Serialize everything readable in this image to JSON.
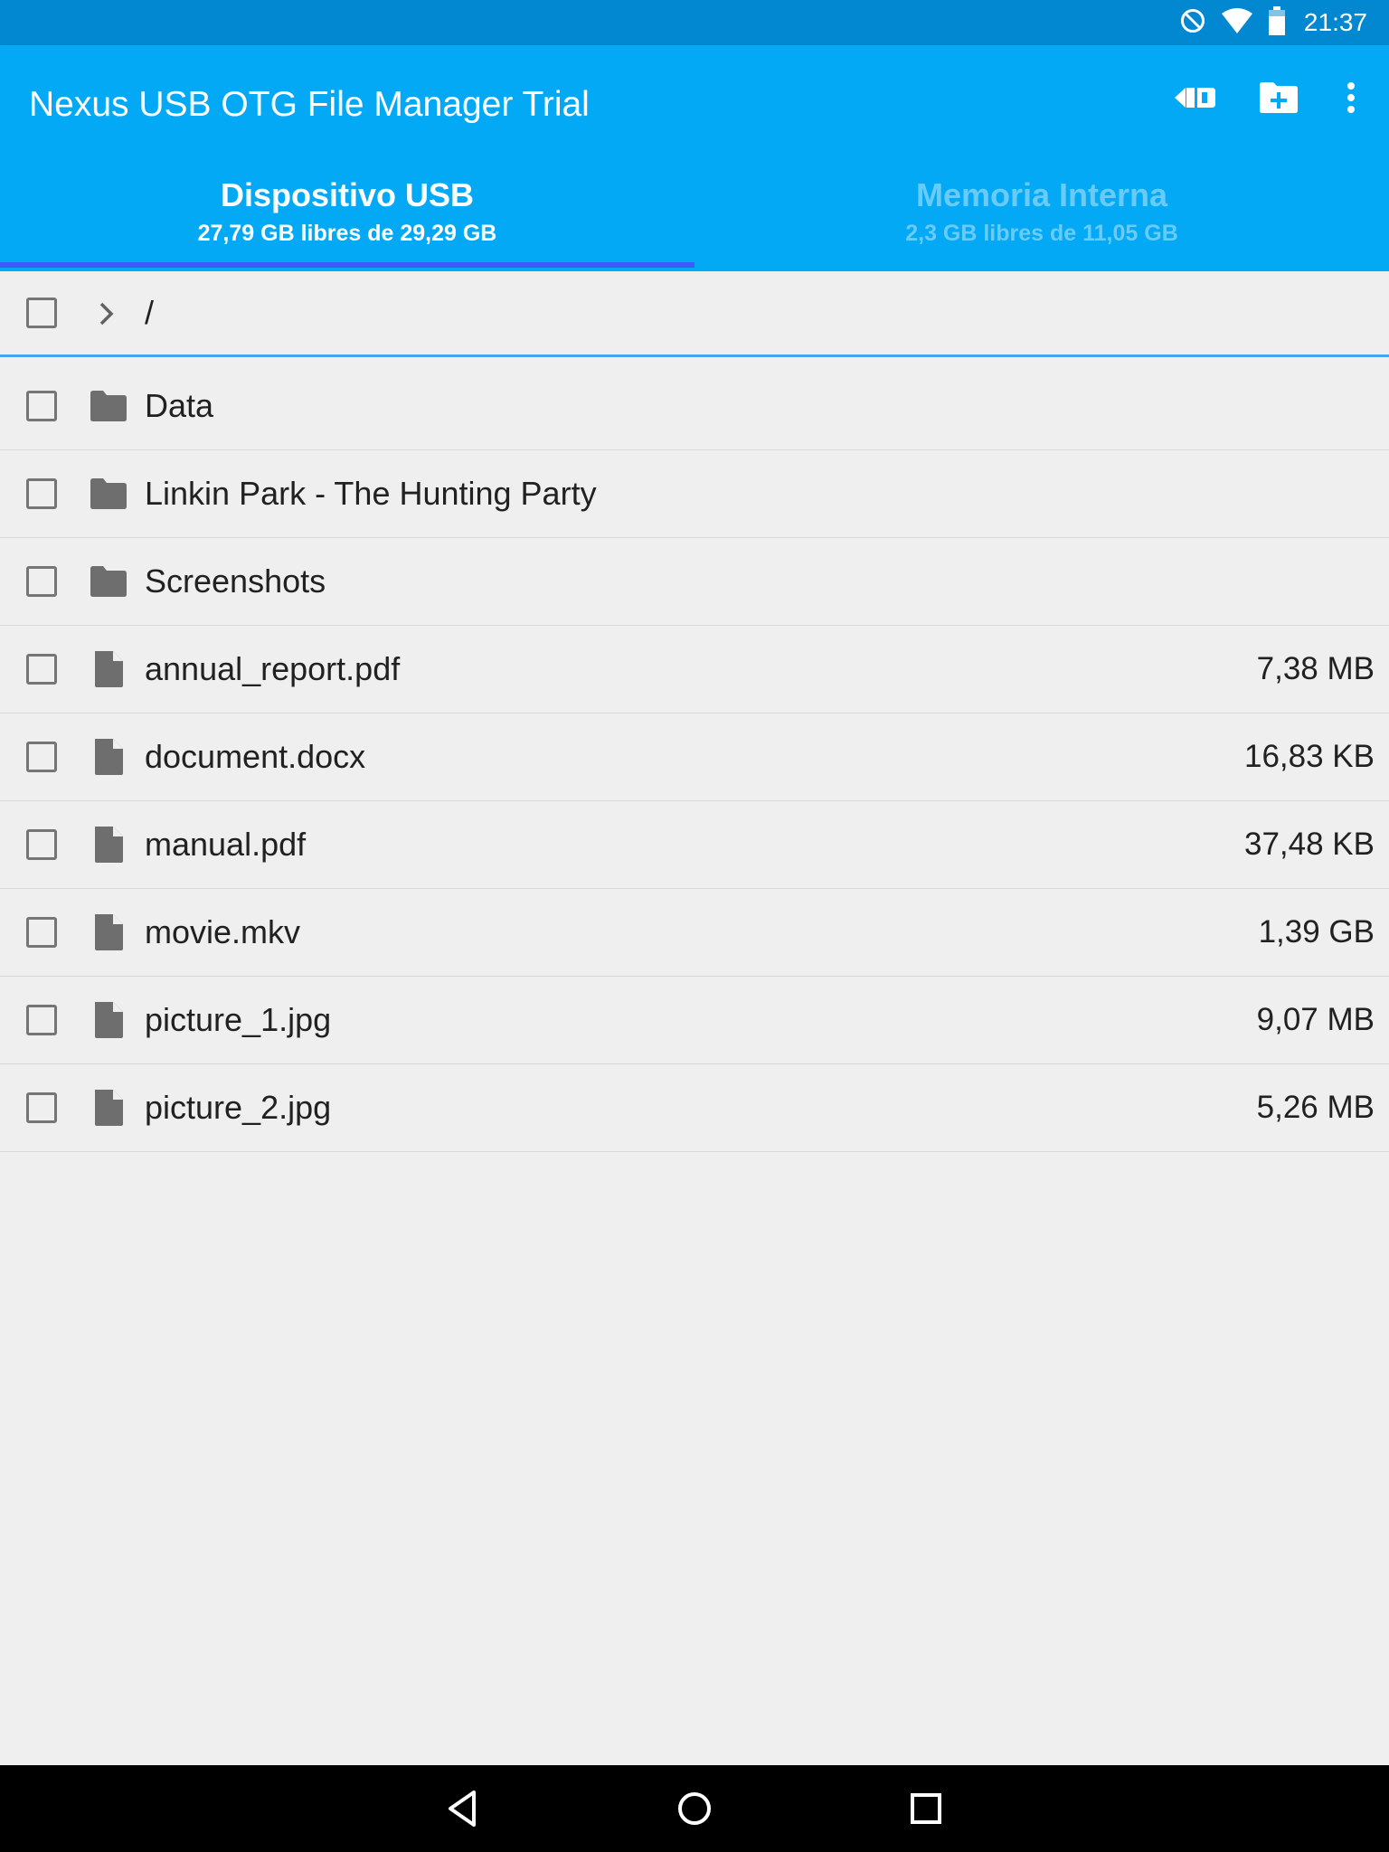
{
  "status_bar": {
    "time": "21:37",
    "icons": [
      "do-not-disturb-icon",
      "wifi-icon",
      "battery-icon"
    ],
    "background": "#0288d1"
  },
  "app_bar": {
    "title": "Nexus USB OTG File Manager Trial",
    "background": "#03a9f4",
    "actions": [
      "switch-storage-icon",
      "new-folder-icon",
      "more-vert-icon"
    ]
  },
  "tabs": [
    {
      "label": "Dispositivo USB",
      "subtitle": "27,79 GB libres de 29,29 GB",
      "selected": true
    },
    {
      "label": "Memoria Interna",
      "subtitle": "2,3 GB libres de 11,05 GB",
      "selected": false
    }
  ],
  "tab_indicator_color": "#3d5afe",
  "path": {
    "current": "/"
  },
  "files": [
    {
      "name": "Data",
      "type": "folder",
      "size": ""
    },
    {
      "name": "Linkin Park - The Hunting Party",
      "type": "folder",
      "size": ""
    },
    {
      "name": "Screenshots",
      "type": "folder",
      "size": ""
    },
    {
      "name": "annual_report.pdf",
      "type": "file",
      "size": "7,38 MB"
    },
    {
      "name": "document.docx",
      "type": "file",
      "size": "16,83 KB"
    },
    {
      "name": "manual.pdf",
      "type": "file",
      "size": "37,48 KB"
    },
    {
      "name": "movie.mkv",
      "type": "file",
      "size": "1,39 GB"
    },
    {
      "name": "picture_1.jpg",
      "type": "file",
      "size": "9,07 MB"
    },
    {
      "name": "picture_2.jpg",
      "type": "file",
      "size": "5,26 MB"
    }
  ],
  "nav_bar": {
    "buttons": [
      "back-icon",
      "home-icon",
      "recents-icon"
    ]
  }
}
